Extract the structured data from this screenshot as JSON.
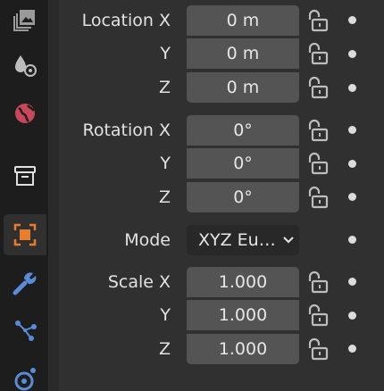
{
  "location": {
    "label_x": "Location X",
    "label_y": "Y",
    "label_z": "Z",
    "x": "0 m",
    "y": "0 m",
    "z": "0 m"
  },
  "rotation": {
    "label_x": "Rotation X",
    "label_y": "Y",
    "label_z": "Z",
    "x": "0°",
    "y": "0°",
    "z": "0°"
  },
  "mode": {
    "label": "Mode",
    "value": "XYZ Eu…"
  },
  "scale": {
    "label_x": "Scale X",
    "label_y": "Y",
    "label_z": "Z",
    "x": "1.000",
    "y": "1.000",
    "z": "1.000"
  },
  "sidebar": {
    "tabs": [
      "render-layers-icon",
      "world-material-icon",
      "scene-world-icon",
      "collection-box-icon",
      "object-transform-icon",
      "modifier-wrench-icon",
      "particles-icon",
      "physics-icon"
    ],
    "accent": "#e87d2d"
  },
  "colors": {
    "panel_bg": "#303030",
    "sidebar_bg": "#1d1d1d",
    "field_bg": "#545454",
    "select_bg": "#282828",
    "text": "#e2e2e2"
  }
}
